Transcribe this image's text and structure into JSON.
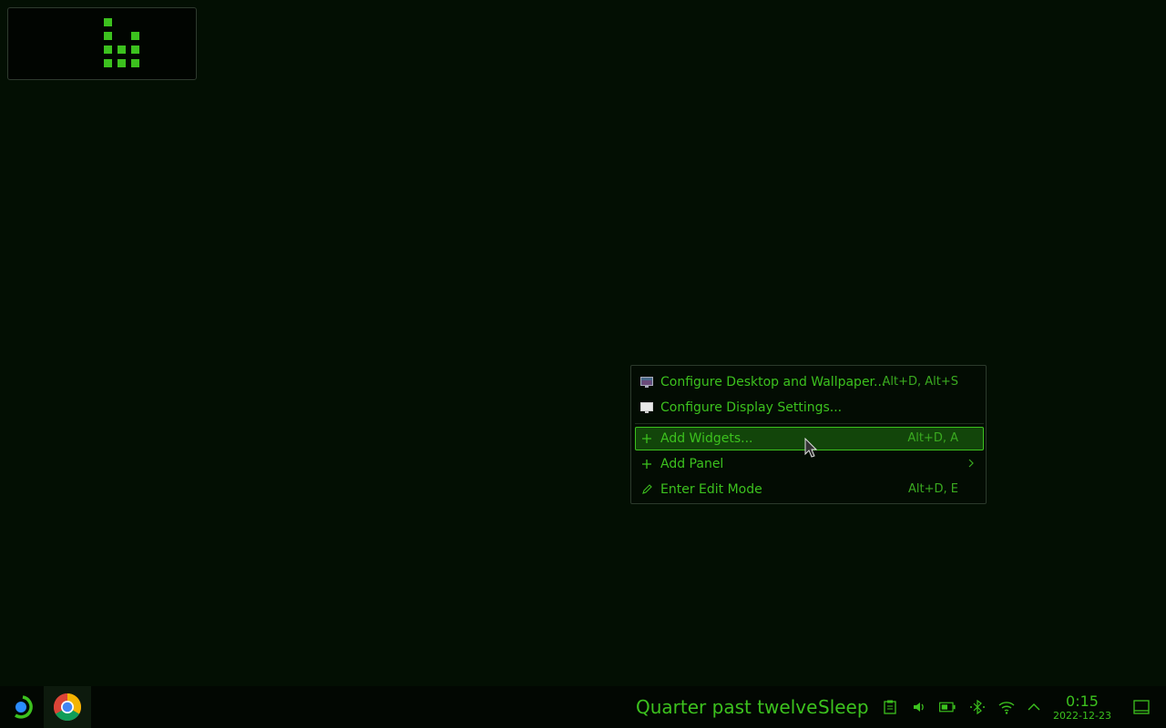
{
  "context_menu": {
    "items": [
      {
        "icon": "desktop-wallpaper-icon",
        "label": "Configure Desktop and Wallpaper...",
        "shortcut": "Alt+D, Alt+S"
      },
      {
        "icon": "display-icon",
        "label": "Configure Display Settings...",
        "shortcut": ""
      },
      {
        "icon": "plus-icon",
        "label": "Add Widgets...",
        "shortcut": "Alt+D, A",
        "highlighted": true
      },
      {
        "icon": "plus-icon",
        "label": "Add Panel",
        "shortcut": "",
        "submenu": true
      },
      {
        "icon": "pencil-icon",
        "label": "Enter Edit Mode",
        "shortcut": "Alt+D, E"
      }
    ]
  },
  "taskbar": {
    "fuzzy_clock": "Quarter past twelve",
    "sleep_label": "Sleep",
    "tray_icons": [
      "clipboard-icon",
      "volume-icon",
      "battery-icon",
      "bluetooth-icon",
      "wifi-icon",
      "chevron-up-icon"
    ],
    "clock": {
      "time": "0:15",
      "date": "2022-12-23"
    },
    "tasks": [
      "chrome-icon"
    ]
  },
  "colors": {
    "background": "#030f03",
    "accent": "#3cc11e",
    "highlight": "#12450a",
    "taskbar": "#020702"
  }
}
